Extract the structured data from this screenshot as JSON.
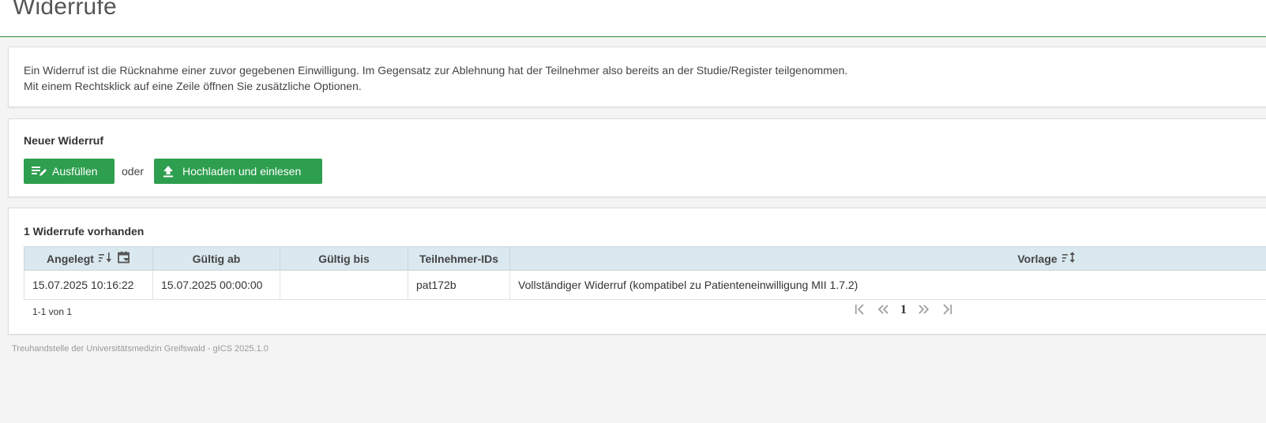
{
  "header": {
    "title": "Widerrufe"
  },
  "info": {
    "line1": "Ein Widerruf ist die Rücknahme einer zuvor gegebenen Einwilligung. Im Gegensatz zur Ablehnung hat der Teilnehmer also bereits an der Studie/Register teilgenommen.",
    "line2": "Mit einem Rechtsklick auf eine Zeile öffnen Sie zusätzliche Optionen."
  },
  "new_revocation": {
    "title": "Neuer Widerruf",
    "fill_label": "Ausfüllen",
    "or_label": "oder",
    "upload_label": "Hochladen und einlesen"
  },
  "list": {
    "title": "1 Widerrufe vorhanden",
    "columns": [
      "Angelegt",
      "Gültig ab",
      "Gültig bis",
      "Teilnehmer-IDs",
      "Vorlage"
    ],
    "rows": [
      {
        "created": "15.07.2025 10:16:22",
        "valid_from": "15.07.2025 00:00:00",
        "valid_to": "",
        "participant_ids": "pat172b",
        "template": "Vollständiger Widerruf (kompatibel zu Patienteneinwilligung MII 1.7.2)"
      }
    ],
    "paging_info": "1-1 von 1",
    "current_page": "1"
  },
  "footer": {
    "text": "Treuhandstelle der Universitätsmedizin Greifswald - gICS 2025.1.0"
  },
  "colors": {
    "accent_green": "#2e9e4f",
    "header_border": "#2e8b3e",
    "table_header_bg": "#dae8ef"
  },
  "icons": {
    "fill_button": "edit-list-icon",
    "upload_button": "upload-icon",
    "sort_created": "sort-descending-icon",
    "filter_created": "calendar-filter-icon",
    "sort_template": "sort-unsorted-icon",
    "pager_first": "first-page-icon",
    "pager_prev": "previous-page-icon",
    "pager_next": "next-page-icon",
    "pager_last": "last-page-icon"
  }
}
